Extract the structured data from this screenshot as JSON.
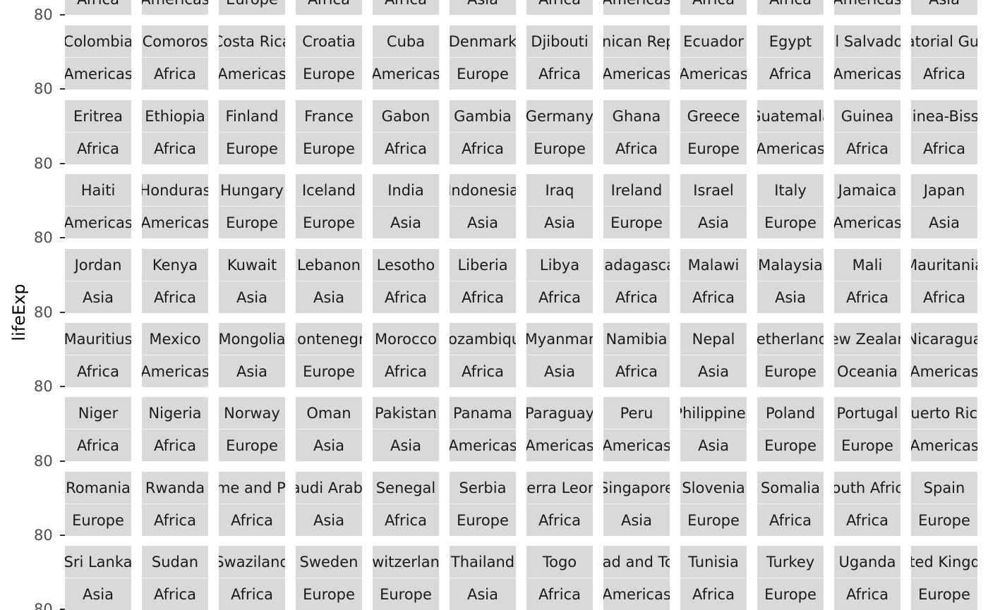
{
  "chart_data": {
    "type": "line",
    "title": "",
    "ylabel": "lifeExp",
    "facet_labels": [
      {
        "country": "",
        "continent": "Africa"
      },
      {
        "country": "",
        "continent": "Americas"
      },
      {
        "country": "",
        "continent": "Europe"
      },
      {
        "country": "",
        "continent": "Africa"
      },
      {
        "country": "",
        "continent": "Africa"
      },
      {
        "country": "",
        "continent": "Asia"
      },
      {
        "country": "",
        "continent": "Africa"
      },
      {
        "country": "",
        "continent": "Americas"
      },
      {
        "country": "",
        "continent": "Africa"
      },
      {
        "country": "",
        "continent": "Africa"
      },
      {
        "country": "",
        "continent": "Americas"
      },
      {
        "country": "",
        "continent": "Asia"
      },
      {
        "country": "Colombia",
        "continent": "Americas"
      },
      {
        "country": "Comoros",
        "continent": "Africa"
      },
      {
        "country": "Costa Rica",
        "continent": "Americas"
      },
      {
        "country": "Croatia",
        "continent": "Europe"
      },
      {
        "country": "Cuba",
        "continent": "Americas"
      },
      {
        "country": "Denmark",
        "continent": "Europe"
      },
      {
        "country": "Djibouti",
        "continent": "Africa"
      },
      {
        "country": "Dominican Republic",
        "continent": "Americas"
      },
      {
        "country": "Ecuador",
        "continent": "Americas"
      },
      {
        "country": "Egypt",
        "continent": "Africa"
      },
      {
        "country": "El Salvador",
        "continent": "Americas"
      },
      {
        "country": "Equatorial Guinea",
        "continent": "Africa"
      },
      {
        "country": "Eritrea",
        "continent": "Africa"
      },
      {
        "country": "Ethiopia",
        "continent": "Africa"
      },
      {
        "country": "Finland",
        "continent": "Europe"
      },
      {
        "country": "France",
        "continent": "Europe"
      },
      {
        "country": "Gabon",
        "continent": "Africa"
      },
      {
        "country": "Gambia",
        "continent": "Africa"
      },
      {
        "country": "Germany",
        "continent": "Europe"
      },
      {
        "country": "Ghana",
        "continent": "Africa"
      },
      {
        "country": "Greece",
        "continent": "Europe"
      },
      {
        "country": "Guatemala",
        "continent": "Americas"
      },
      {
        "country": "Guinea",
        "continent": "Africa"
      },
      {
        "country": "Guinea-Bissau",
        "continent": "Africa"
      },
      {
        "country": "Haiti",
        "continent": "Americas"
      },
      {
        "country": "Honduras",
        "continent": "Americas"
      },
      {
        "country": "Hungary",
        "continent": "Europe"
      },
      {
        "country": "Iceland",
        "continent": "Europe"
      },
      {
        "country": "India",
        "continent": "Asia"
      },
      {
        "country": "Indonesia",
        "continent": "Asia"
      },
      {
        "country": "Iraq",
        "continent": "Asia"
      },
      {
        "country": "Ireland",
        "continent": "Europe"
      },
      {
        "country": "Israel",
        "continent": "Asia"
      },
      {
        "country": "Italy",
        "continent": "Europe"
      },
      {
        "country": "Jamaica",
        "continent": "Americas"
      },
      {
        "country": "Japan",
        "continent": "Asia"
      },
      {
        "country": "Jordan",
        "continent": "Asia"
      },
      {
        "country": "Kenya",
        "continent": "Africa"
      },
      {
        "country": "Kuwait",
        "continent": "Asia"
      },
      {
        "country": "Lebanon",
        "continent": "Asia"
      },
      {
        "country": "Lesotho",
        "continent": "Africa"
      },
      {
        "country": "Liberia",
        "continent": "Africa"
      },
      {
        "country": "Libya",
        "continent": "Africa"
      },
      {
        "country": "Madagascar",
        "continent": "Africa"
      },
      {
        "country": "Malawi",
        "continent": "Africa"
      },
      {
        "country": "Malaysia",
        "continent": "Asia"
      },
      {
        "country": "Mali",
        "continent": "Africa"
      },
      {
        "country": "Mauritania",
        "continent": "Africa"
      },
      {
        "country": "Mauritius",
        "continent": "Africa"
      },
      {
        "country": "Mexico",
        "continent": "Americas"
      },
      {
        "country": "Mongolia",
        "continent": "Asia"
      },
      {
        "country": "Montenegro",
        "continent": "Europe"
      },
      {
        "country": "Morocco",
        "continent": "Africa"
      },
      {
        "country": "Mozambique",
        "continent": "Africa"
      },
      {
        "country": "Myanmar",
        "continent": "Asia"
      },
      {
        "country": "Namibia",
        "continent": "Africa"
      },
      {
        "country": "Nepal",
        "continent": "Asia"
      },
      {
        "country": "Netherlands",
        "continent": "Europe"
      },
      {
        "country": "New Zealand",
        "continent": "Oceania"
      },
      {
        "country": "Nicaragua",
        "continent": "Americas"
      },
      {
        "country": "Niger",
        "continent": "Africa"
      },
      {
        "country": "Nigeria",
        "continent": "Africa"
      },
      {
        "country": "Norway",
        "continent": "Europe"
      },
      {
        "country": "Oman",
        "continent": "Asia"
      },
      {
        "country": "Pakistan",
        "continent": "Asia"
      },
      {
        "country": "Panama",
        "continent": "Americas"
      },
      {
        "country": "Paraguay",
        "continent": "Americas"
      },
      {
        "country": "Peru",
        "continent": "Americas"
      },
      {
        "country": "Philippines",
        "continent": "Asia"
      },
      {
        "country": "Poland",
        "continent": "Europe"
      },
      {
        "country": "Portugal",
        "continent": "Europe"
      },
      {
        "country": "Puerto Rico",
        "continent": "Americas"
      },
      {
        "country": "Romania",
        "continent": "Europe"
      },
      {
        "country": "Rwanda",
        "continent": "Africa"
      },
      {
        "country": "Sao Tome and Principe",
        "continent": "Africa"
      },
      {
        "country": "Saudi Arabia",
        "continent": "Asia"
      },
      {
        "country": "Senegal",
        "continent": "Africa"
      },
      {
        "country": "Serbia",
        "continent": "Europe"
      },
      {
        "country": "Sierra Leone",
        "continent": "Africa"
      },
      {
        "country": "Singapore",
        "continent": "Asia"
      },
      {
        "country": "Slovenia",
        "continent": "Europe"
      },
      {
        "country": "Somalia",
        "continent": "Africa"
      },
      {
        "country": "South Africa",
        "continent": "Africa"
      },
      {
        "country": "Spain",
        "continent": "Europe"
      },
      {
        "country": "Sri Lanka",
        "continent": "Asia"
      },
      {
        "country": "Sudan",
        "continent": "Africa"
      },
      {
        "country": "Swaziland",
        "continent": "Africa"
      },
      {
        "country": "Sweden",
        "continent": "Europe"
      },
      {
        "country": "Switzerland",
        "continent": "Europe"
      },
      {
        "country": "Thailand",
        "continent": "Asia"
      },
      {
        "country": "Togo",
        "continent": "Africa"
      },
      {
        "country": "Trinidad and Tobago",
        "continent": "Americas"
      },
      {
        "country": "Tunisia",
        "continent": "Africa"
      },
      {
        "country": "Turkey",
        "continent": "Europe"
      },
      {
        "country": "Uganda",
        "continent": "Africa"
      },
      {
        "country": "United Kingdom",
        "continent": "Europe"
      }
    ],
    "y_tick_label": "80",
    "strip_color": "#d9d9d9",
    "text_color": "#1a1a1a",
    "grid": false
  }
}
